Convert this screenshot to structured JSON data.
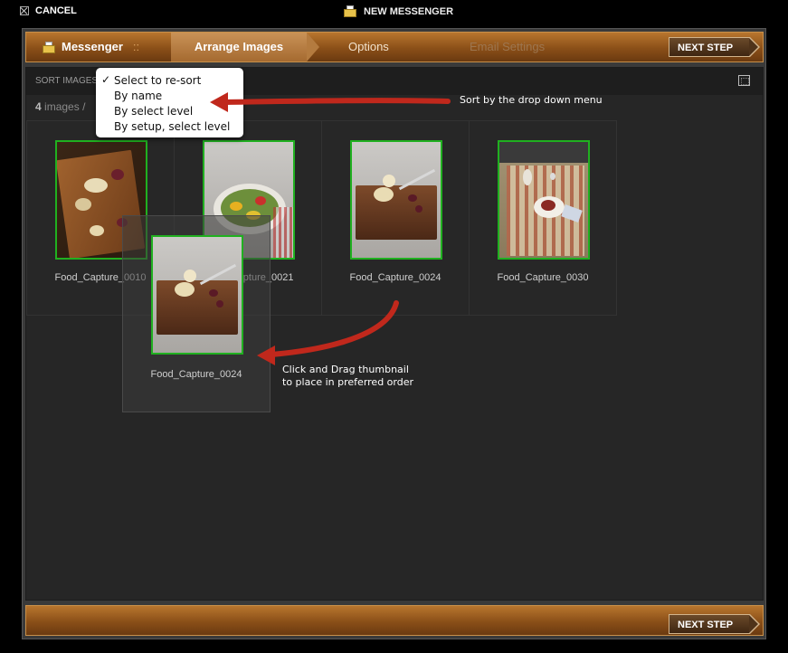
{
  "topbar": {
    "cancel_label": "CANCEL",
    "window_title": "NEW MESSENGER"
  },
  "wizard": {
    "steps": [
      {
        "label": "Messenger",
        "sep": "::"
      },
      {
        "label": "Arrange Images"
      },
      {
        "label": "Options"
      },
      {
        "label": "Email Settings"
      }
    ],
    "next_label": "NEXT STEP"
  },
  "sort": {
    "label": "SORT IMAGES",
    "options": [
      "Select to re-sort",
      "By name",
      "By select level",
      "By setup, select level"
    ],
    "checkmark": "✓"
  },
  "count": {
    "number": "4",
    "unit": "images",
    "sep": "/"
  },
  "images": [
    {
      "name": "Food_Capture_0010"
    },
    {
      "name": "Food_Capture_0021"
    },
    {
      "name": "Food_Capture_0024"
    },
    {
      "name": "Food_Capture_0030"
    }
  ],
  "drag": {
    "name": "Food_Capture_0024"
  },
  "annotations": {
    "sort_hint": "Sort by the drop down menu",
    "drag_hint_line1": "Click and Drag thumbnail",
    "drag_hint_line2": "to place in preferred order"
  },
  "colors": {
    "accent": "#8a4f18",
    "selection": "#20b020",
    "annotation_arrow": "#c0281c"
  }
}
